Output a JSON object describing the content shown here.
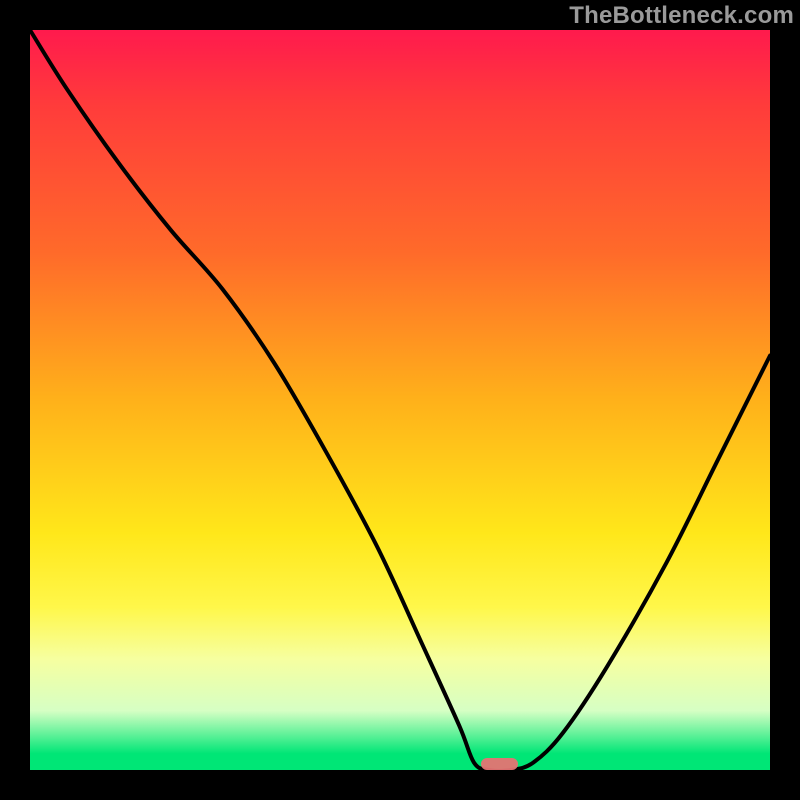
{
  "watermark": "TheBottleneck.com",
  "chart_data": {
    "type": "line",
    "title": "",
    "xlabel": "",
    "ylabel": "",
    "xlim": [
      0,
      100
    ],
    "ylim": [
      0,
      100
    ],
    "grid": false,
    "series": [
      {
        "name": "curve",
        "x": [
          0,
          5,
          12,
          19,
          26,
          33,
          40,
          47,
          53,
          58,
          60,
          62,
          65,
          68,
          72,
          78,
          86,
          93,
          100
        ],
        "y": [
          100,
          92,
          82,
          73,
          65,
          55,
          43,
          30,
          17,
          6,
          1,
          0,
          0,
          1,
          5,
          14,
          28,
          42,
          56
        ]
      }
    ],
    "sweet_spot_x": [
      61,
      66
    ],
    "background_gradient_top": "#ff1a4d",
    "background_gradient_bottom": "#00e676"
  }
}
